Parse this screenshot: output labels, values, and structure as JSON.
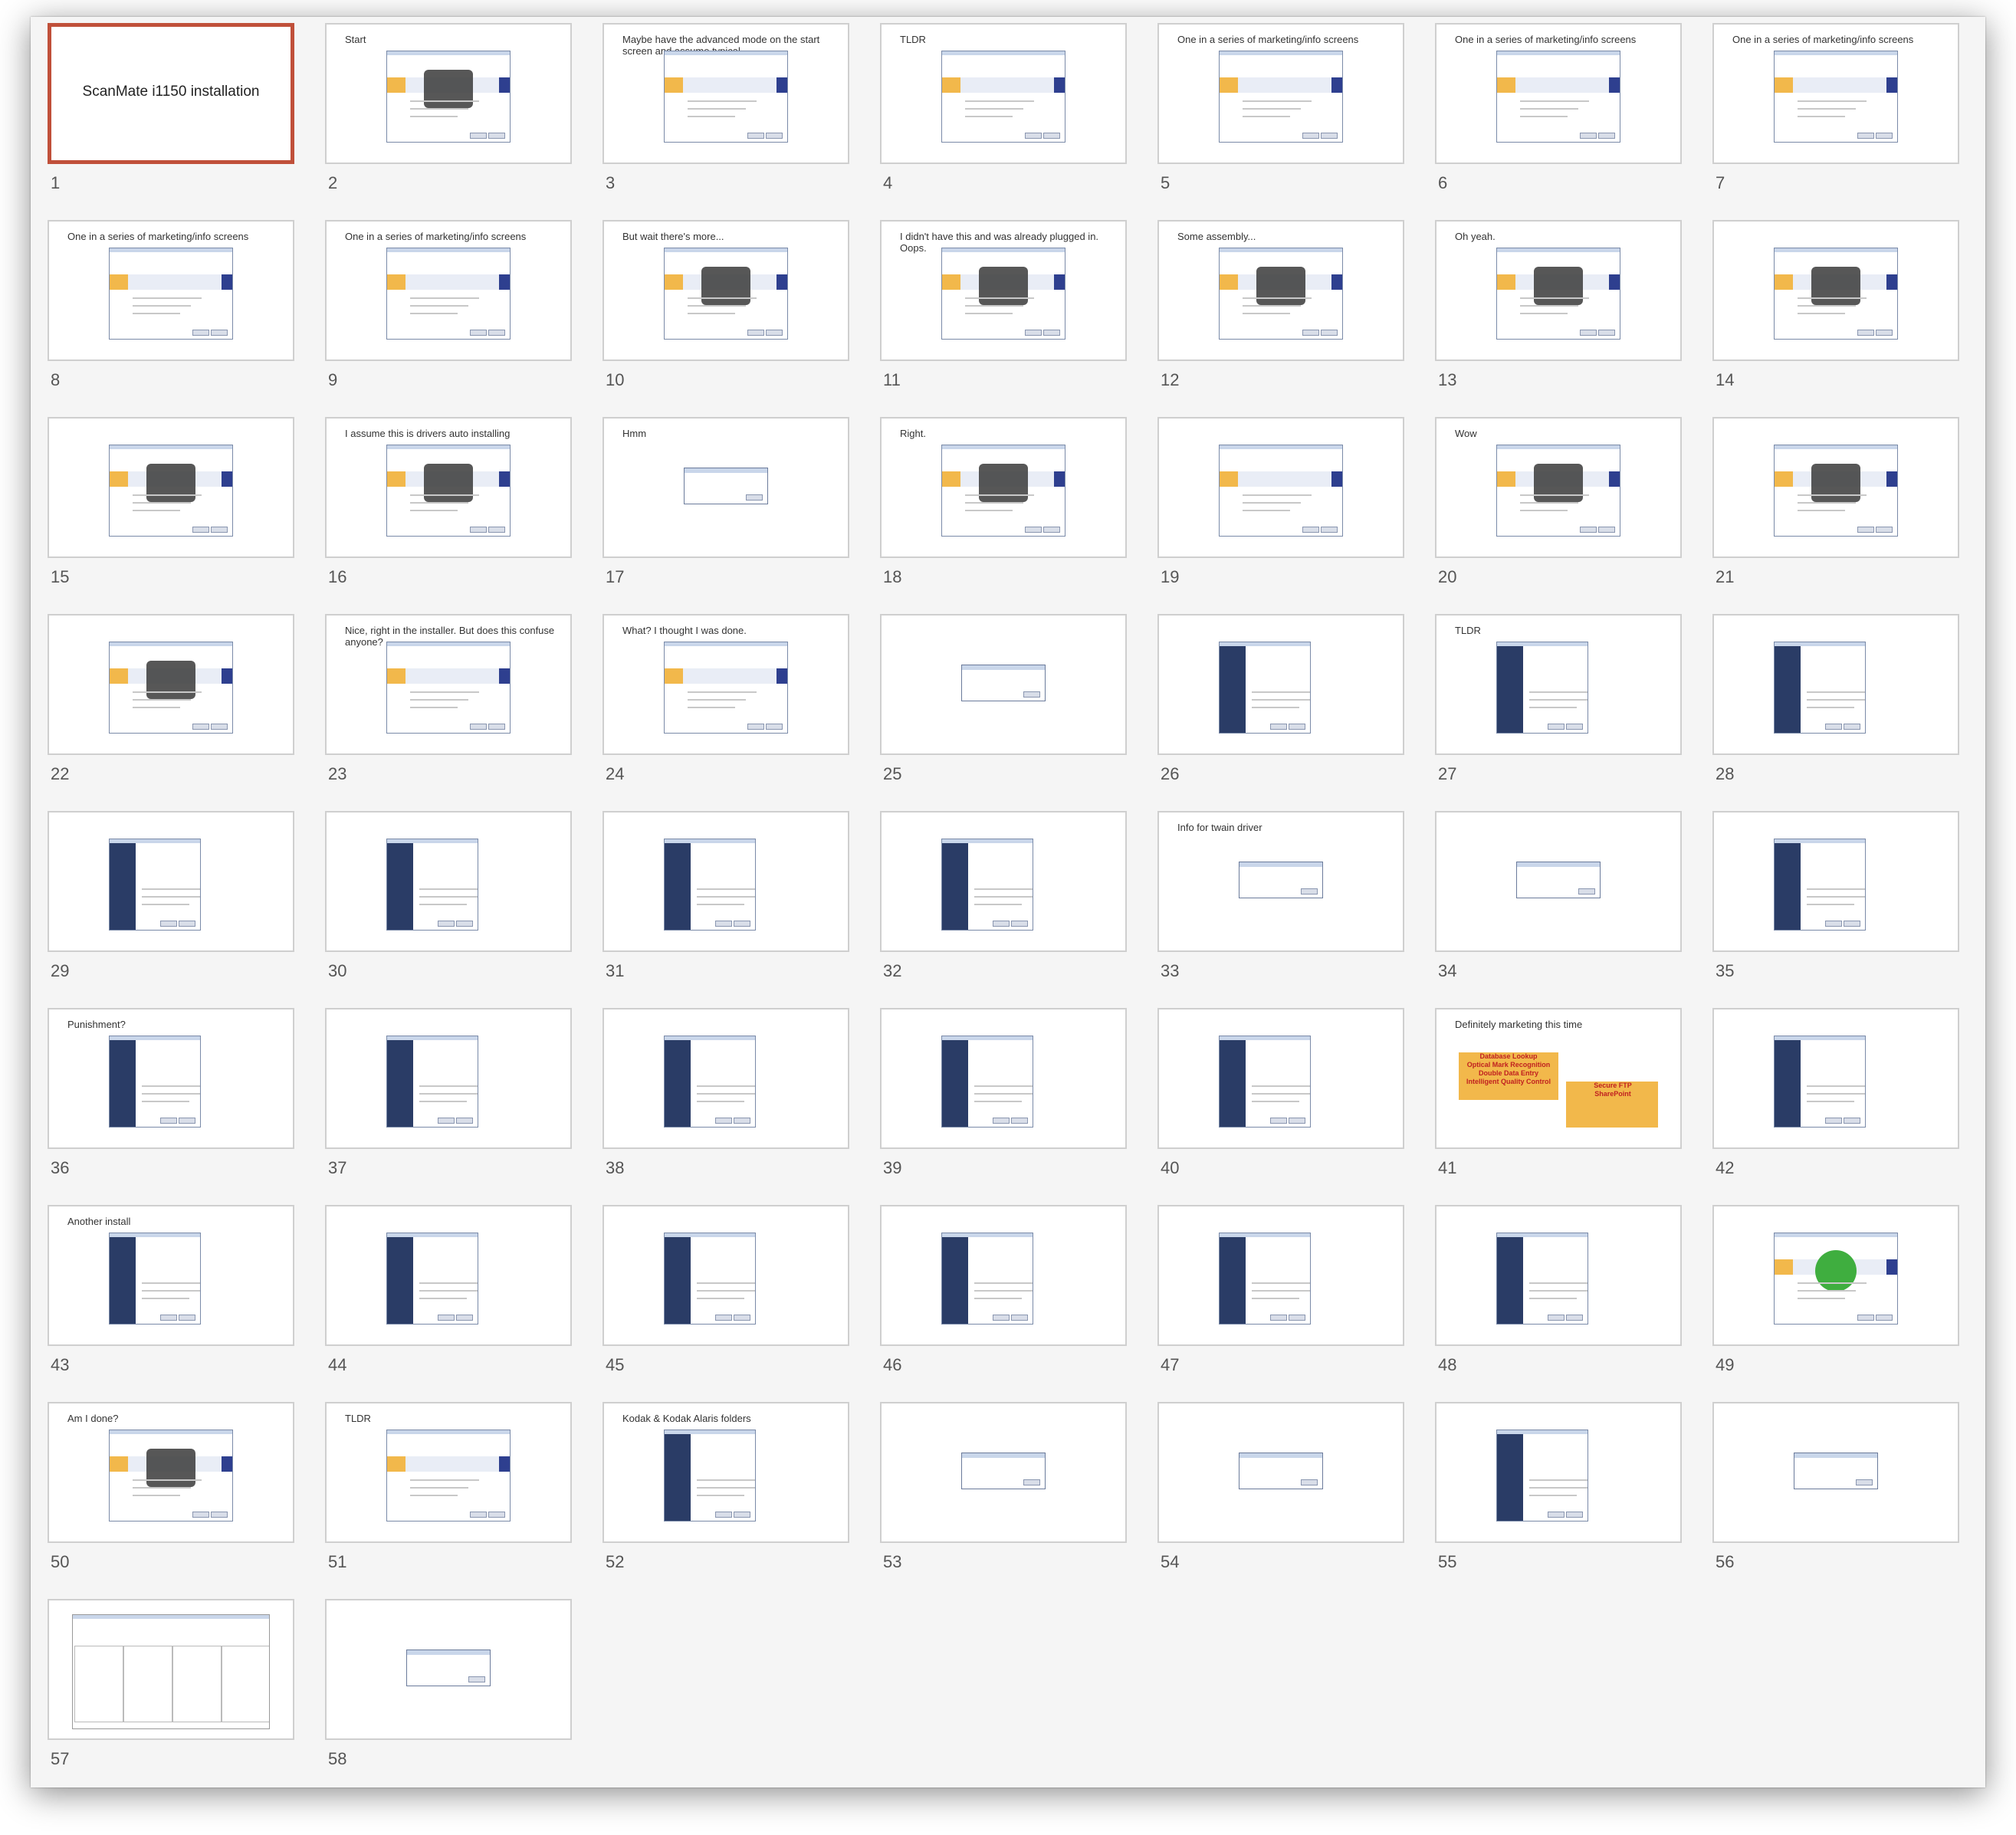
{
  "app": {
    "selected_slide": 1
  },
  "slides": [
    {
      "num": "1",
      "title": "ScanMate i1150 installation",
      "caption": "",
      "kind": "title"
    },
    {
      "num": "2",
      "caption": "Start",
      "kind": "img"
    },
    {
      "num": "3",
      "caption": "Maybe have the advanced mode on the start screen and assume typical",
      "kind": "plain"
    },
    {
      "num": "4",
      "caption": "TLDR",
      "kind": "plain"
    },
    {
      "num": "5",
      "caption": "One in a series of marketing/info screens",
      "kind": "plain"
    },
    {
      "num": "6",
      "caption": "One in a series of marketing/info screens",
      "kind": "plain"
    },
    {
      "num": "7",
      "caption": "One in a series of marketing/info screens",
      "kind": "plain"
    },
    {
      "num": "8",
      "caption": "One in a series of marketing/info screens",
      "kind": "plain"
    },
    {
      "num": "9",
      "caption": "One in a series of marketing/info screens",
      "kind": "plain"
    },
    {
      "num": "10",
      "caption": "But wait there's more...",
      "kind": "img"
    },
    {
      "num": "11",
      "caption": "I didn't have this and was already plugged in. Oops.",
      "kind": "img"
    },
    {
      "num": "12",
      "caption": "Some assembly...",
      "kind": "img"
    },
    {
      "num": "13",
      "caption": "Oh yeah.",
      "kind": "img"
    },
    {
      "num": "14",
      "caption": "",
      "kind": "img"
    },
    {
      "num": "15",
      "caption": "",
      "kind": "img"
    },
    {
      "num": "16",
      "caption": "I assume this is drivers auto installing",
      "kind": "img"
    },
    {
      "num": "17",
      "caption": "Hmm",
      "kind": "dlg"
    },
    {
      "num": "18",
      "caption": "Right.",
      "kind": "img"
    },
    {
      "num": "19",
      "caption": "",
      "kind": "plain"
    },
    {
      "num": "20",
      "caption": "Wow",
      "kind": "img"
    },
    {
      "num": "21",
      "caption": "",
      "kind": "img"
    },
    {
      "num": "22",
      "caption": "",
      "kind": "img"
    },
    {
      "num": "23",
      "caption": "Nice, right in the installer. But does this confuse anyone?",
      "kind": "plain"
    },
    {
      "num": "24",
      "caption": "What? I thought I was done.",
      "kind": "plain"
    },
    {
      "num": "25",
      "caption": "",
      "kind": "dlg"
    },
    {
      "num": "26",
      "caption": "",
      "kind": "side"
    },
    {
      "num": "27",
      "caption": "TLDR",
      "kind": "side"
    },
    {
      "num": "28",
      "caption": "",
      "kind": "side"
    },
    {
      "num": "29",
      "caption": "",
      "kind": "side"
    },
    {
      "num": "30",
      "caption": "",
      "kind": "side"
    },
    {
      "num": "31",
      "caption": "",
      "kind": "side"
    },
    {
      "num": "32",
      "caption": "",
      "kind": "side"
    },
    {
      "num": "33",
      "caption": "Info for twain driver",
      "kind": "dlg"
    },
    {
      "num": "34",
      "caption": "",
      "kind": "dlg"
    },
    {
      "num": "35",
      "caption": "",
      "kind": "side"
    },
    {
      "num": "36",
      "caption": "Punishment?",
      "kind": "side"
    },
    {
      "num": "37",
      "caption": "",
      "kind": "side"
    },
    {
      "num": "38",
      "caption": "",
      "kind": "side"
    },
    {
      "num": "39",
      "caption": "",
      "kind": "side"
    },
    {
      "num": "40",
      "caption": "",
      "kind": "side"
    },
    {
      "num": "41",
      "caption": "Definitely marketing this time",
      "kind": "mkt"
    },
    {
      "num": "42",
      "caption": "",
      "kind": "side"
    },
    {
      "num": "43",
      "caption": "Another install",
      "kind": "side"
    },
    {
      "num": "44",
      "caption": "",
      "kind": "side"
    },
    {
      "num": "45",
      "caption": "",
      "kind": "side"
    },
    {
      "num": "46",
      "caption": "",
      "kind": "side"
    },
    {
      "num": "47",
      "caption": "",
      "kind": "side"
    },
    {
      "num": "48",
      "caption": "",
      "kind": "side"
    },
    {
      "num": "49",
      "caption": "",
      "kind": "check"
    },
    {
      "num": "50",
      "caption": "Am I done?",
      "kind": "img"
    },
    {
      "num": "51",
      "caption": "TLDR",
      "kind": "plain"
    },
    {
      "num": "52",
      "caption": "Kodak & Kodak Alaris folders",
      "kind": "side"
    },
    {
      "num": "53",
      "caption": "",
      "kind": "dlg"
    },
    {
      "num": "54",
      "caption": "",
      "kind": "dlg"
    },
    {
      "num": "55",
      "caption": "",
      "kind": "side"
    },
    {
      "num": "56",
      "caption": "",
      "kind": "dlg"
    },
    {
      "num": "57",
      "caption": "",
      "kind": "app"
    },
    {
      "num": "58",
      "caption": "",
      "kind": "dlg"
    }
  ],
  "marketing": {
    "box1": [
      "Database Lookup",
      "Optical Mark Recognition",
      "Double Data Entry",
      "Intelligent Quality Control"
    ],
    "box2": [
      "Secure FTP",
      "SharePoint"
    ]
  }
}
